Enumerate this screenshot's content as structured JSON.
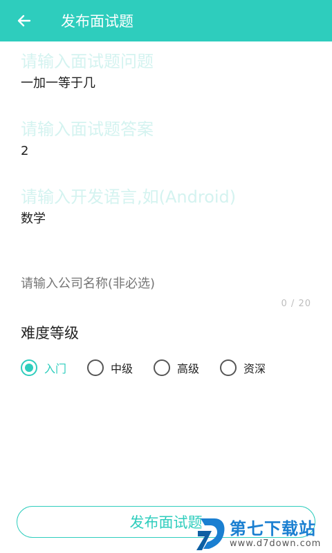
{
  "appbar": {
    "title": "发布面试题",
    "back_icon": "arrow-left-icon"
  },
  "form": {
    "question": {
      "label": "请输入面试题问题",
      "value": "一加一等于几"
    },
    "answer": {
      "label": "请输入面试题答案",
      "value": "2"
    },
    "language": {
      "label": "请输入开发语言,如(Android)",
      "value": "数学"
    },
    "company": {
      "placeholder": "请输入公司名称(非必选)",
      "counter": "0 / 20"
    }
  },
  "difficulty": {
    "title": "难度等级",
    "options": [
      "入门",
      "中级",
      "高级",
      "资深"
    ],
    "selected": "入门"
  },
  "submit_label": "发布面试题",
  "watermark": {
    "name": "第七下载站",
    "url": "www.d7down.com"
  },
  "colors": {
    "accent": "#2ecdbd",
    "label_faded": "#d4f3f0",
    "watermark_blue": "#1a7fd1"
  }
}
